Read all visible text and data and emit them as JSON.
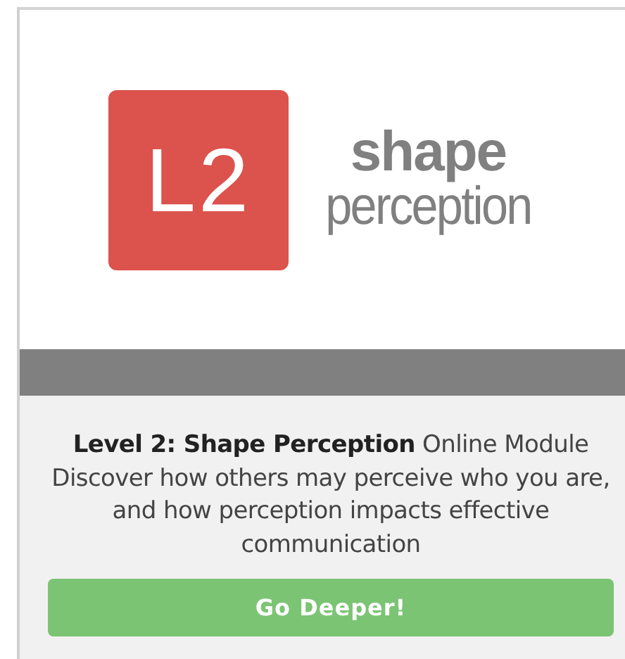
{
  "logo": {
    "badge": "L2",
    "word_1": "shape",
    "word_2": "perception"
  },
  "description": "**Level 2: Shape Perception** Online Module Discover how others may perceive who you are, and how perception impacts effective communication",
  "button": "Go Deeper!"
}
